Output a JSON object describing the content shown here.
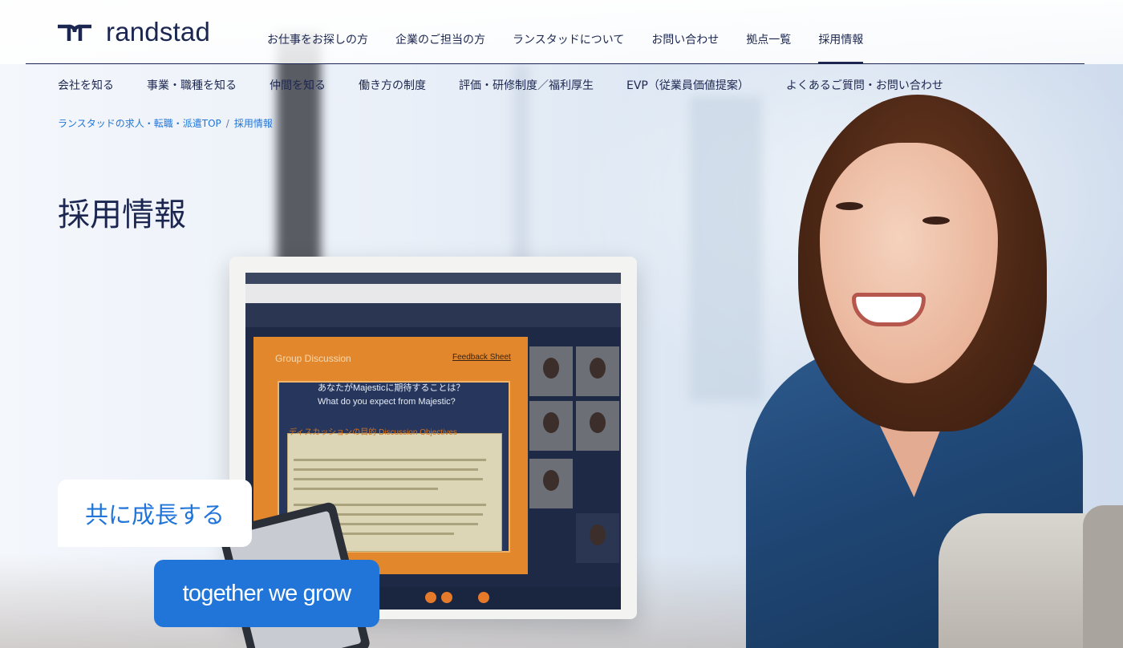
{
  "brand": {
    "name": "randstad",
    "color": "#1c2751",
    "accent": "#2175d9"
  },
  "main_nav": [
    {
      "label": "お仕事をお探しの方",
      "active": false
    },
    {
      "label": "企業のご担当の方",
      "active": false
    },
    {
      "label": "ランスタッドについて",
      "active": false
    },
    {
      "label": "お問い合わせ",
      "active": false
    },
    {
      "label": "拠点一覧",
      "active": false
    },
    {
      "label": "採用情報",
      "active": true
    }
  ],
  "sub_nav": [
    {
      "label": "会社を知る"
    },
    {
      "label": "事業・職種を知る"
    },
    {
      "label": "仲間を知る"
    },
    {
      "label": "働き方の制度"
    },
    {
      "label": "評価・研修制度／福利厚生"
    },
    {
      "label": "EVP（従業員価値提案）"
    },
    {
      "label": "よくあるご質問・お問い合わせ"
    }
  ],
  "breadcrumb": [
    {
      "label": "ランスタッドの求人・転職・派遣TOP"
    },
    {
      "label": "採用情報"
    }
  ],
  "breadcrumb_separator": "/",
  "page_title": "採用情報",
  "hero": {
    "tagline_ja": "共に成長する",
    "tagline_en": "together we grow",
    "screen_slide_title": "Group Discussion",
    "screen_slide_link": "Feedback Sheet",
    "screen_question_ja": "あなたがMajesticに期待することは？",
    "screen_question_en": "What do you expect from Majestic?",
    "screen_note_title": "ディスカッションの目的 Discussion Objectives"
  }
}
